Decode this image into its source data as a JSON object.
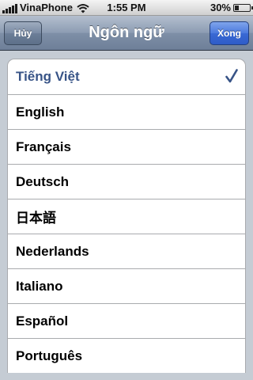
{
  "status_bar": {
    "carrier": "VinaPhone",
    "time": "1:55 PM",
    "battery_percent": "30%",
    "signal_bars": 5,
    "battery_level": 0.3
  },
  "nav": {
    "title": "Ngôn ngữ",
    "cancel_label": "Hủy",
    "done_label": "Xong"
  },
  "languages": {
    "items": [
      {
        "label": "Tiếng Việt",
        "selected": true
      },
      {
        "label": "English",
        "selected": false
      },
      {
        "label": "Français",
        "selected": false
      },
      {
        "label": "Deutsch",
        "selected": false
      },
      {
        "label": "日本語",
        "selected": false
      },
      {
        "label": "Nederlands",
        "selected": false
      },
      {
        "label": "Italiano",
        "selected": false
      },
      {
        "label": "Español",
        "selected": false
      },
      {
        "label": "Português",
        "selected": false
      }
    ]
  },
  "colors": {
    "selected_text": "#385487",
    "checkmark": "#385487",
    "background": "#c5ccd4"
  },
  "icons": {
    "checkmark": "checkmark-icon",
    "wifi": "wifi-icon",
    "signal": "signal-bars-icon",
    "battery": "battery-icon"
  }
}
